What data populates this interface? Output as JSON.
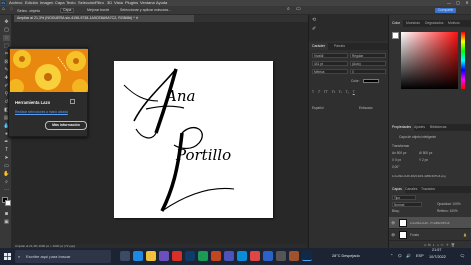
{
  "menubar": {
    "app_icon": "Ps",
    "items": [
      "Archivo",
      "Edición",
      "Imagen",
      "Capa",
      "Texto",
      "Selección",
      "Filtro",
      "3D",
      "Vista",
      "Plugins",
      "Ventana",
      "Ayuda"
    ],
    "window_controls": [
      "—",
      "▢",
      "✕"
    ]
  },
  "options": {
    "tool_label": "Selec. objeto",
    "mode": "Capa",
    "checkbox_label": "Mejorar borde",
    "refine": "Seleccionar y aplicar máscara...",
    "share": "Compartir"
  },
  "document": {
    "tab_title": "Ampliar al 21,3% (NOGUERA sin-4196-9738-1A9CE8A9A7C2, RGB/8#) * ✕",
    "status": "Ampliar al 21,3%   1000 px × 1000 px (72 ppp)"
  },
  "canvas_text": {
    "line1": "Ana",
    "line2": "Portillo"
  },
  "tooltip": {
    "title": "Herramienta Lazo",
    "link": "Realizar selecciones a mano alzada",
    "button": "Más información"
  },
  "character_panel": {
    "tabs": [
      "Carácter",
      "Párrafo"
    ],
    "font_family": "Vivaldi",
    "font_style": "Regular",
    "size": "441 pt",
    "leading": "(Auto)",
    "tracking": "Métrica",
    "scale": "0",
    "color_label": "Color:",
    "footer_left": "Español",
    "footer_right": "Enfocado"
  },
  "color_panel": {
    "tabs": [
      "Color",
      "Muestras",
      "Degradados",
      "Motivos"
    ]
  },
  "properties_panel": {
    "tabs": [
      "Propiedades",
      "Ajustes",
      "Bibliotecas"
    ],
    "type_label": "Capa de objeto inteligente",
    "section": "Transformar",
    "w_label": "An 500 px",
    "h_label": "Al 500 px",
    "x_label": "X 0 px",
    "y_label": "Y 2 px",
    "angle": "0,00°",
    "file": "1c1e09d-c1d6-48e5-9df1-4dff6c93f7e6.png"
  },
  "layers_panel": {
    "tabs": [
      "Capas",
      "Canales",
      "Trazados"
    ],
    "kind": "Tipo",
    "blend": "Normal",
    "opacity": "Opacidad: 100%",
    "lock": "Bloq.:",
    "fill": "Relleno: 100%",
    "layers": [
      {
        "name": "1c1e09d-c1d6...7f-4dff6c93f7e6",
        "selected": true
      },
      {
        "name": "Fondo",
        "selected": false
      }
    ]
  },
  "taskbar": {
    "search_placeholder": "Escribe aquí para buscar",
    "weather": "28°C  Despejado",
    "lang": "ESP",
    "time": "21:57",
    "date": "10/7/2022"
  },
  "colors": {
    "accent": "#4ba3f5",
    "canvas": "#ffffff",
    "workspace": "#282828",
    "panel": "#323232",
    "tooltip_image": "#e9880f"
  }
}
